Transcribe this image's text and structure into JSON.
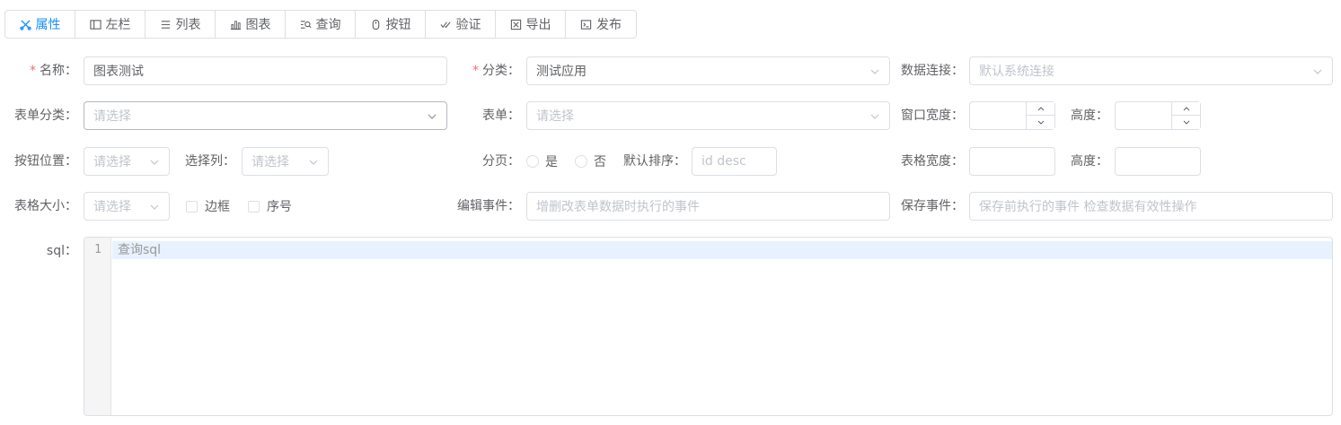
{
  "tabs": [
    {
      "label": "属性",
      "icon": "scissors-icon",
      "active": true
    },
    {
      "label": "左栏",
      "icon": "sidebar-icon",
      "active": false
    },
    {
      "label": "列表",
      "icon": "list-icon",
      "active": false
    },
    {
      "label": "图表",
      "icon": "bar-chart-icon",
      "active": false
    },
    {
      "label": "查询",
      "icon": "search-list-icon",
      "active": false
    },
    {
      "label": "按钮",
      "icon": "mouse-icon",
      "active": false
    },
    {
      "label": "验证",
      "icon": "check-double-icon",
      "active": false
    },
    {
      "label": "导出",
      "icon": "export-icon",
      "active": false
    },
    {
      "label": "发布",
      "icon": "terminal-icon",
      "active": false
    }
  ],
  "colors": {
    "accent": "#1890ff",
    "required": "#f56c6c",
    "border": "#dcdfe6",
    "placeholder": "#c0c4cc"
  },
  "row1": {
    "name_label": "名称：",
    "name_value": "图表测试",
    "category_label": "分类：",
    "category_value": "测试应用",
    "datasource_label": "数据连接：",
    "datasource_placeholder": "默认系统连接"
  },
  "row2": {
    "form_category_label": "表单分类：",
    "form_category_placeholder": "请选择",
    "form_label": "表单：",
    "form_placeholder": "请选择",
    "window_width_label": "窗口宽度：",
    "height_label": "高度："
  },
  "row3": {
    "button_position_label": "按钮位置：",
    "button_position_placeholder": "请选择",
    "select_column_label": "选择列：",
    "select_column_placeholder": "请选择",
    "paging_label": "分页：",
    "paging_yes": "是",
    "paging_no": "否",
    "default_sort_label": "默认排序：",
    "default_sort_placeholder": "id desc",
    "table_width_label": "表格宽度：",
    "height_label": "高度："
  },
  "row4": {
    "table_size_label": "表格大小：",
    "table_size_placeholder": "请选择",
    "border_label": "边框",
    "index_label": "序号",
    "edit_event_label": "编辑事件：",
    "edit_event_placeholder": "增删改表单数据时执行的事件",
    "save_event_label": "保存事件：",
    "save_event_placeholder": "保存前执行的事件 检查数据有效性操作"
  },
  "sql": {
    "label": "sql：",
    "line_number": "1",
    "placeholder": "查询sql"
  }
}
